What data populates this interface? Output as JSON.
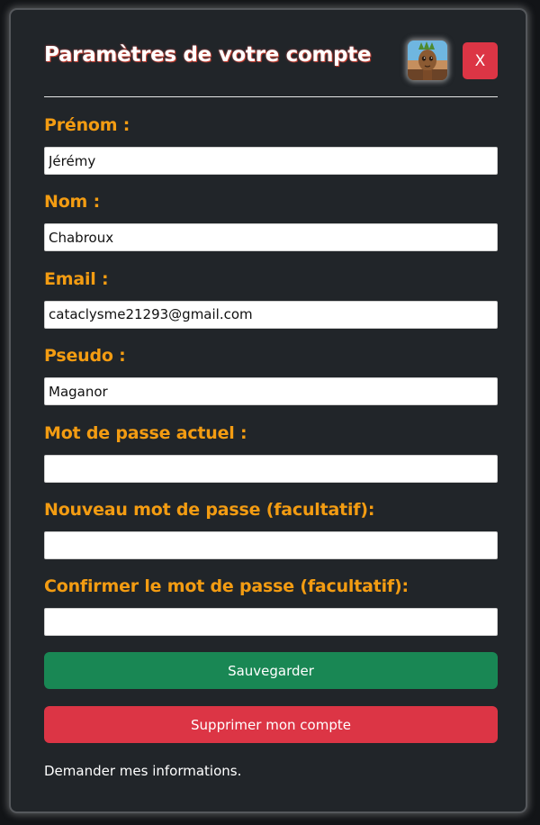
{
  "modal": {
    "title": "Paramètres de votre compte",
    "close_label": "X"
  },
  "fields": [
    {
      "label": "Prénom :",
      "value": ""
    },
    {
      "label": "Nom :",
      "value": "Chabroux"
    },
    {
      "label": "Email :",
      "value": "cataclysme21293@gmail.com"
    },
    {
      "label": "Pseudo :",
      "value": "Maganor"
    },
    {
      "label": "Mot de passe actuel :",
      "value": ""
    },
    {
      "label": "Nouveau mot de passe (facultatif):",
      "value": ""
    },
    {
      "label": "Confirmer le mot de passe (facultatif):",
      "value": ""
    }
  ],
  "first_name_value": "Jérémy",
  "actions": {
    "save_label": "Sauvegarder",
    "delete_label": "Supprimer mon compte",
    "request_info_label": "Demander mes informations."
  },
  "colors": {
    "modal_bg": "#212529",
    "label": "#f39c12",
    "save": "#198754",
    "danger": "#dc3545"
  },
  "icons": {
    "avatar": "groot-avatar-image"
  }
}
